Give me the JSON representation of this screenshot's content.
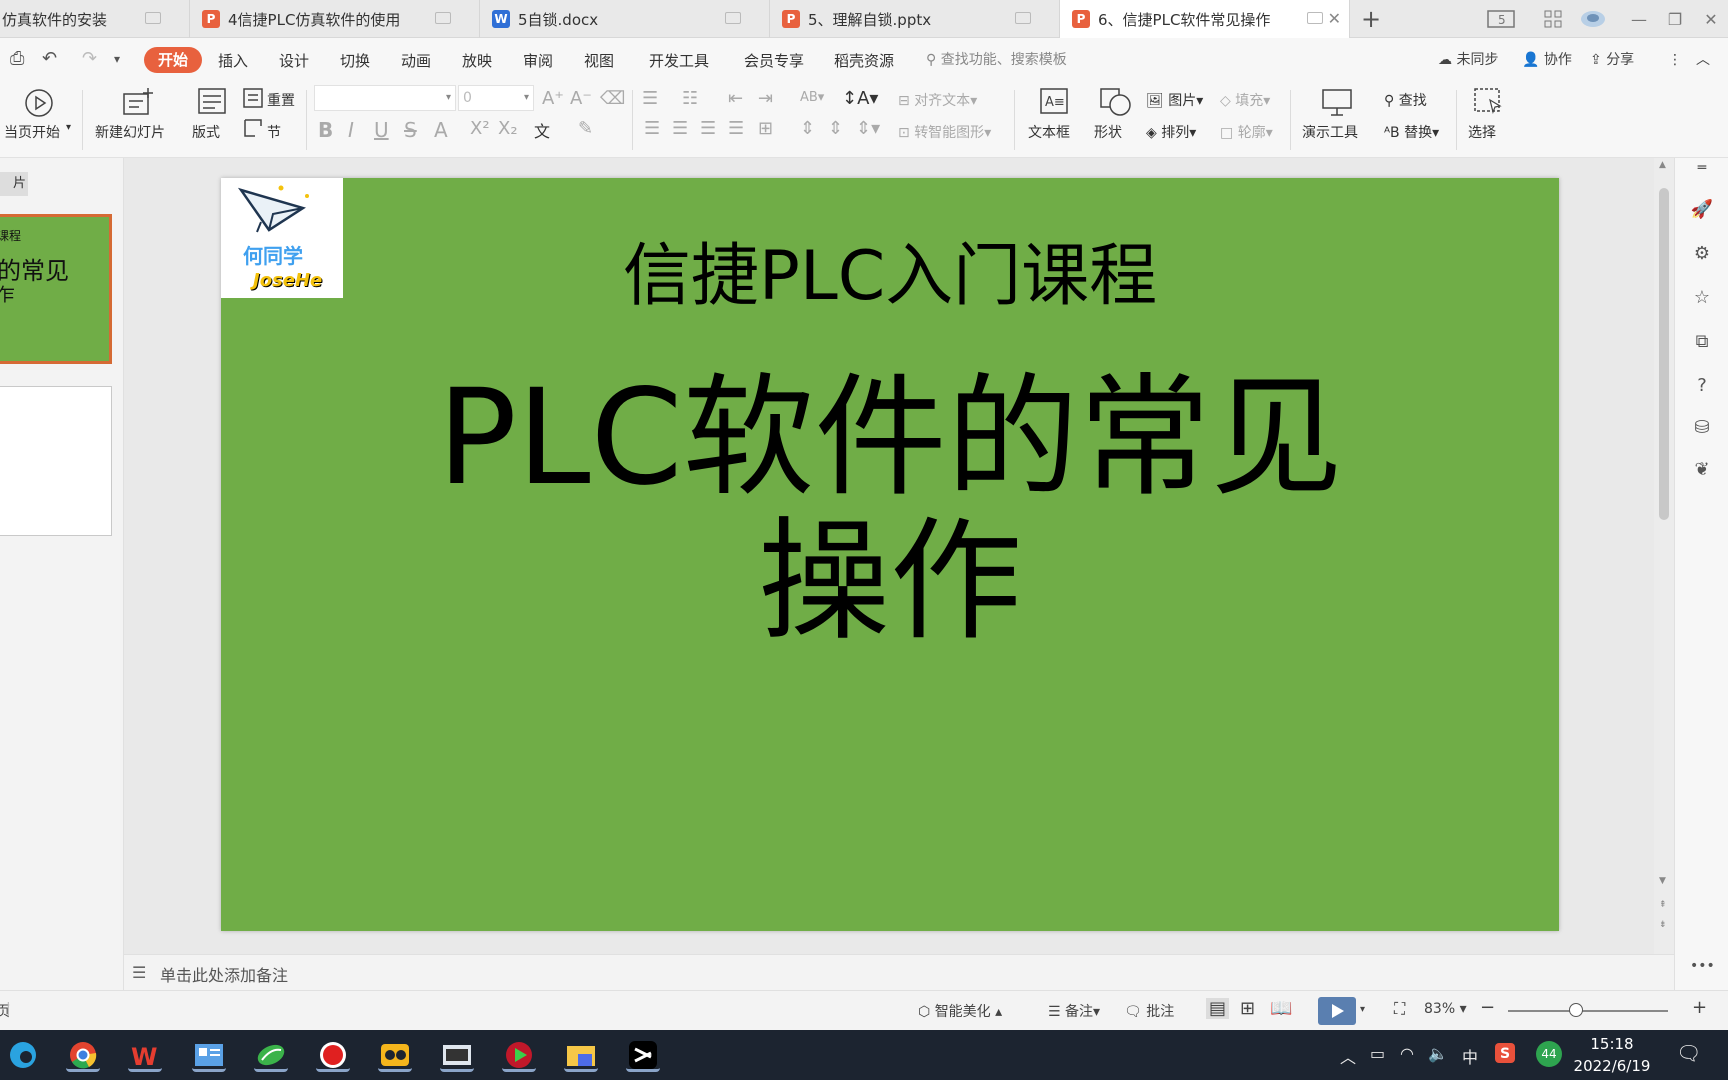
{
  "tabs": [
    {
      "label": "仿真软件的安装",
      "icon": "ppt"
    },
    {
      "label": "4信捷PLC仿真软件的使用",
      "icon": "ppt"
    },
    {
      "label": "5自锁.docx",
      "icon": "word"
    },
    {
      "label": "5、理解自锁.pptx",
      "icon": "ppt"
    },
    {
      "label": "6、信捷PLC软件常见操作",
      "icon": "ppt",
      "active": true
    }
  ],
  "menu": {
    "items": [
      "开始",
      "插入",
      "设计",
      "切换",
      "动画",
      "放映",
      "审阅",
      "视图",
      "开发工具",
      "会员专享",
      "稻壳资源"
    ],
    "search_placeholder": "查找功能、搜索模板",
    "sync": "未同步",
    "collab": "协作",
    "share": "分享"
  },
  "ribbon": {
    "from_current": "当页开始",
    "new_slide": "新建幻灯片",
    "layout": "版式",
    "reset": "重置",
    "section": "节",
    "font_size": "0",
    "align_text": "对齐文本",
    "convert_smartart": "转智能图形",
    "textbox": "文本框",
    "shape": "形状",
    "picture": "图片",
    "fill": "填充",
    "arrange": "排列",
    "outline": "轮廓",
    "presenter": "演示工具",
    "find": "查找",
    "replace": "替换",
    "select": "选择"
  },
  "left_panel": {
    "tab_label": "片",
    "thumb1_line1": "课程",
    "thumb1_line2": "的常见",
    "thumb1_line3": "乍"
  },
  "slide": {
    "logo_line1": "何同学",
    "logo_line2": "JoseHe",
    "title": "信捷PLC入门课程",
    "main_line1": "PLC软件的常见",
    "main_line2": "操作",
    "background_color": "#70ad47"
  },
  "notes_placeholder": "单击此处添加备注",
  "status": {
    "left_text": "页",
    "beautify": "智能美化",
    "notes": "备注",
    "comments": "批注",
    "zoom": "83%"
  },
  "taskbar": {
    "time": "15:18",
    "date": "2022/6/19",
    "ime": "中",
    "badge": "44"
  }
}
